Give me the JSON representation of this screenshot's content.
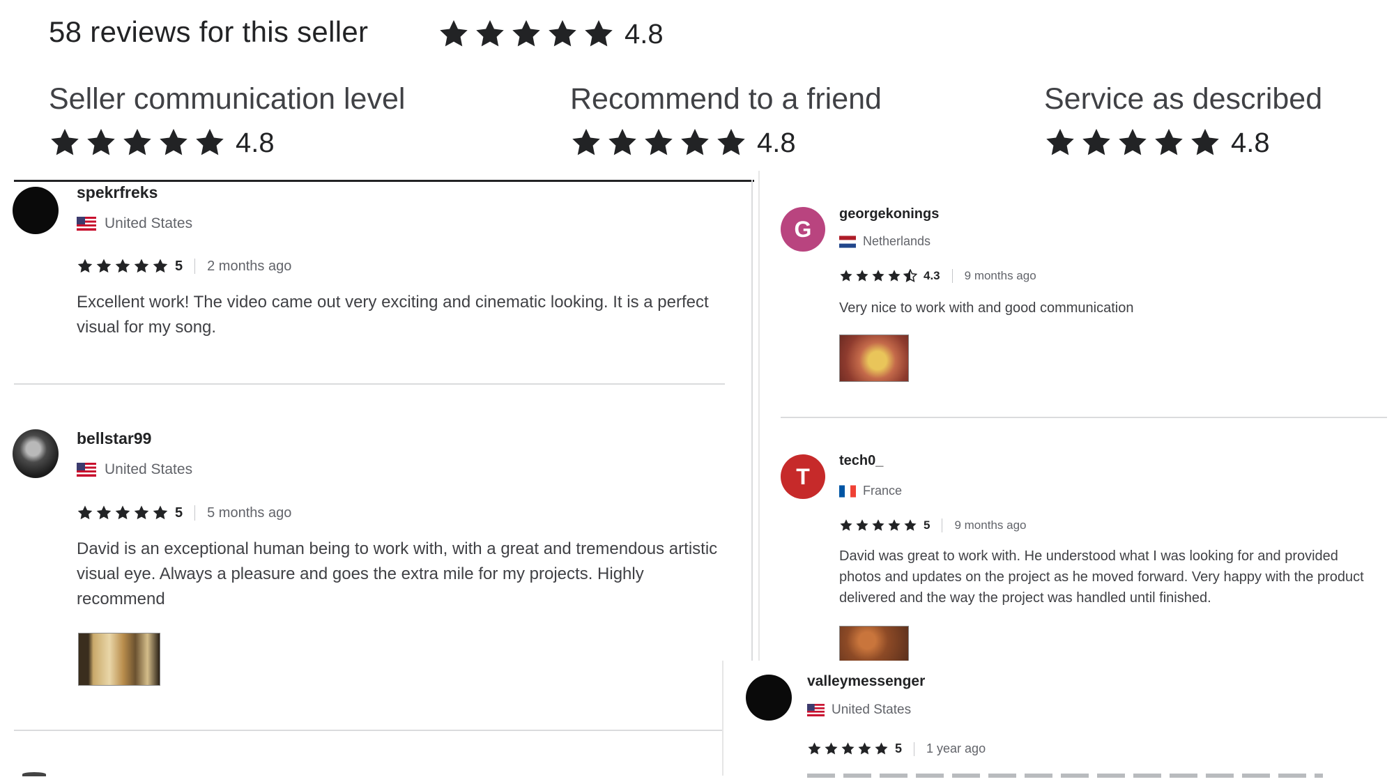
{
  "summary": {
    "title": "58 reviews for this seller",
    "rating": "4.8"
  },
  "categories": [
    {
      "label": "Seller communication level",
      "rating": "4.8"
    },
    {
      "label": "Recommend to a friend",
      "rating": "4.8"
    },
    {
      "label": "Service as described",
      "rating": "4.8"
    }
  ],
  "reviews": [
    {
      "username": "spekrfreks",
      "country": "United States",
      "rating": "5",
      "time": "2 months ago",
      "text": "Excellent work! The video came out very exciting and cinematic looking. It is a perfect visual for my song."
    },
    {
      "username": "bellstar99",
      "country": "United States",
      "rating": "5",
      "time": "5 months ago",
      "text": "David is an exceptional human being to work with, with a great and tremendous artistic visual eye. Always a pleasure and goes the extra mile for my projects. Highly recommend"
    },
    {
      "username": "georgekonings",
      "country": "Netherlands",
      "rating": "4.3",
      "time": "9 months ago",
      "text": "Very nice to work with and good communication",
      "avatar_letter": "G"
    },
    {
      "username": "tech0_",
      "country": "France",
      "rating": "5",
      "time": "9 months ago",
      "text": "David was great to work with. He understood what I was looking for and provided photos and updates on the project as he moved forward. Very happy with the product delivered and the way the project was handled until finished.",
      "avatar_letter": "T"
    },
    {
      "username": "valleymessenger",
      "country": "United States",
      "rating": "5",
      "time": "1 year ago"
    }
  ],
  "colors": {
    "star": "#222325",
    "avatar_g": "#b9447f",
    "avatar_t": "#c62a2a",
    "divider": "#dadbdd"
  }
}
